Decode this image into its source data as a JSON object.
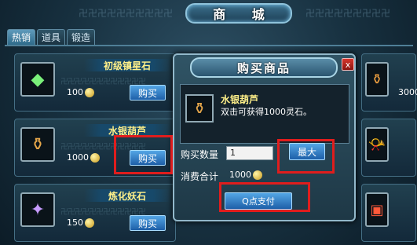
{
  "shop": {
    "title": "商 城",
    "tabs": [
      "热销",
      "道具",
      "锻造"
    ]
  },
  "items": [
    {
      "name": "初级镇星石",
      "price": "100",
      "buy_label": "购买",
      "icon": "green-gem-icon"
    },
    {
      "name": "水银葫芦",
      "price": "1000",
      "buy_label": "购买",
      "icon": "gourd-icon"
    },
    {
      "name": "炼化妖石",
      "price": "150",
      "buy_label": "购买",
      "icon": "purple-gem-icon"
    }
  ],
  "right_items": [
    {
      "price": "3000",
      "icon": "gourd-orange-icon"
    },
    {
      "price": "",
      "icon": "horn-icon"
    },
    {
      "price": "",
      "icon": "red-box-icon"
    }
  ],
  "dialog": {
    "title": "购买商品",
    "close_label": "x",
    "product_name": "水银葫芦",
    "product_desc": "双击可获得1000灵石。",
    "qty_label": "购买数量",
    "qty_value": "1",
    "max_label": "最大",
    "total_label": "消费合计",
    "total_value": "1000",
    "pay_label": "Q点支付"
  },
  "colors": {
    "highlight": "#e01d1d",
    "button": "#1d5fa8",
    "item_name": "#fff089"
  }
}
